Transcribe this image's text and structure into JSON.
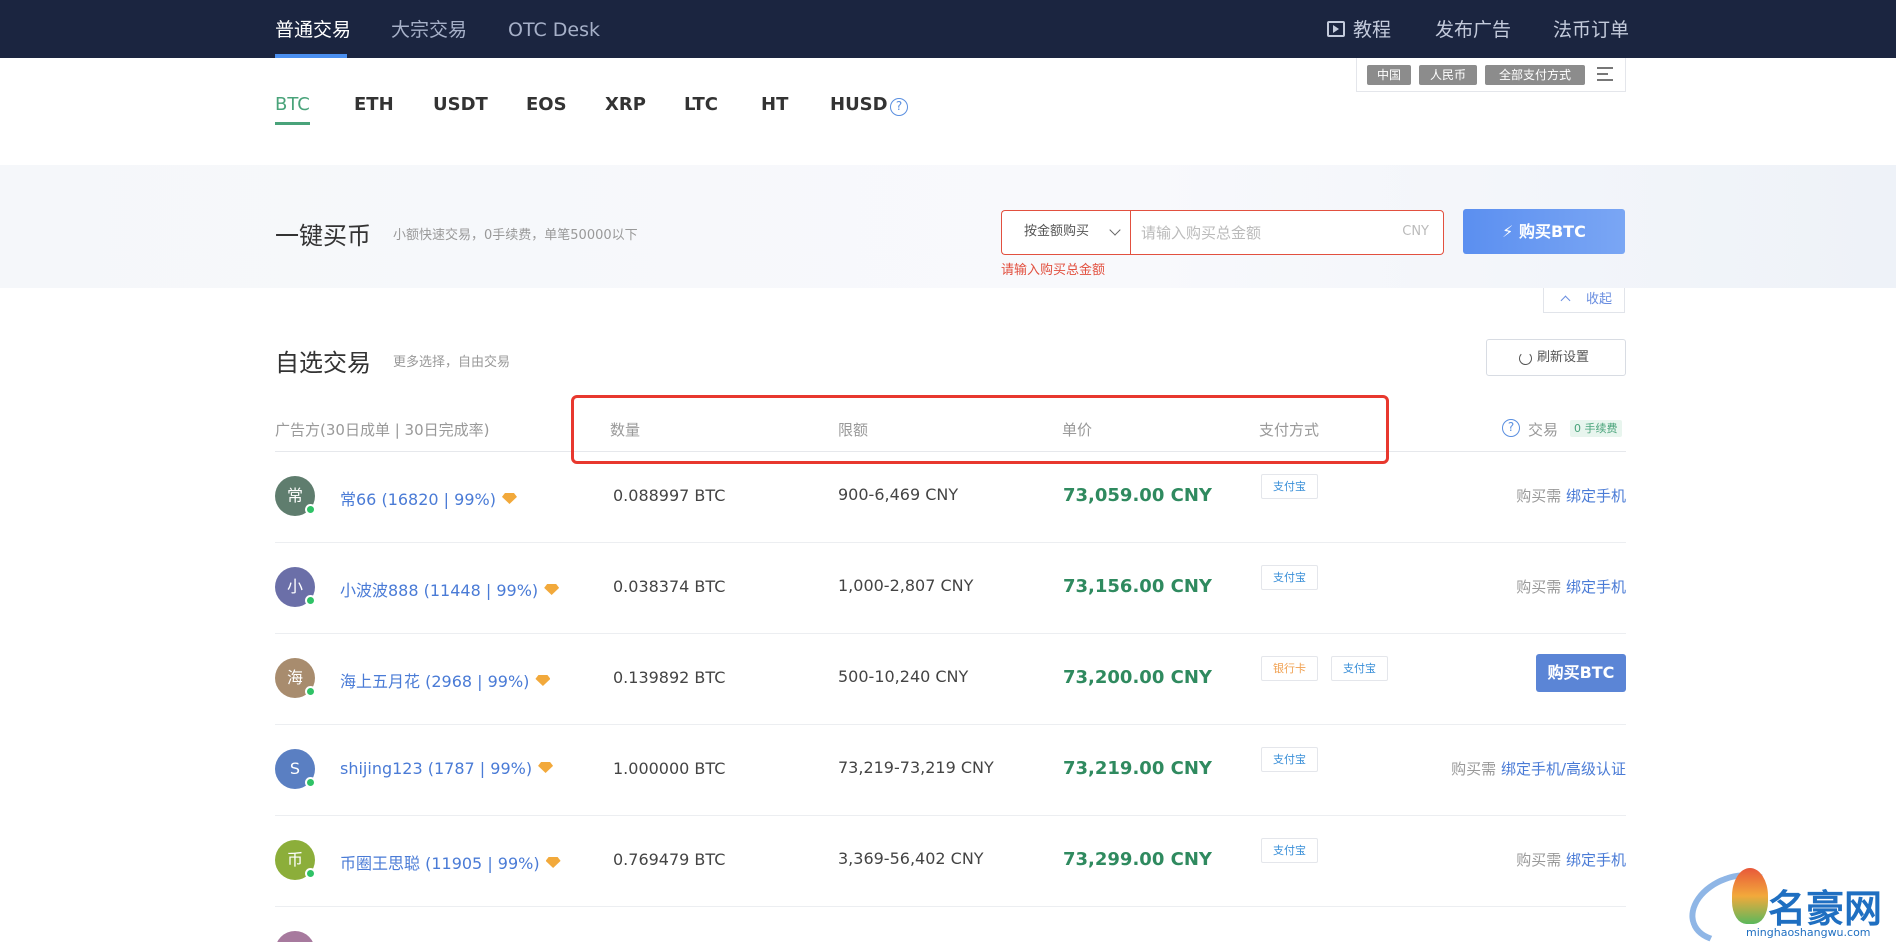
{
  "topnav": {
    "tabs": [
      {
        "label": "普通交易",
        "active": true
      },
      {
        "label": "大宗交易",
        "active": false
      },
      {
        "label": "OTC Desk",
        "active": false
      }
    ],
    "right": {
      "tutorial": "教程",
      "post_ad": "发布广告",
      "orders": "法币订单"
    }
  },
  "coins": [
    "BTC",
    "ETH",
    "USDT",
    "EOS",
    "XRP",
    "LTC",
    "HT",
    "HUSD"
  ],
  "coin_help": "?",
  "filters": {
    "region": "中国",
    "currency": "人民币",
    "payment": "全部支付方式"
  },
  "quick_buy": {
    "title": "一键买币",
    "subtitle": "小额快速交易，0手续费，单笔50000以下",
    "mode": "按金额购买",
    "placeholder": "请输入购买总金额",
    "unit": "CNY",
    "error": "请输入购买总金额",
    "button": "⚡ 购买BTC",
    "collapse": "收起"
  },
  "custom": {
    "title": "自选交易",
    "subtitle": "更多选择，自由交易",
    "refresh": "刷新设置"
  },
  "table": {
    "headers": {
      "advertiser": "广告方(30日成单 | 30日完成率)",
      "qty": "数量",
      "limit": "限额",
      "price": "单价",
      "payment": "支付方式",
      "help": "?",
      "trade": "交易",
      "fee": "0 手续费"
    },
    "rows": [
      {
        "avatar": "常",
        "avatar_color": "#5f7d6e",
        "name": "常66 (16820 | 99%)",
        "qty": "0.088997 BTC",
        "limit": "900-6,469 CNY",
        "price": "73,059.00 CNY",
        "payments": [
          "支付宝"
        ],
        "action_prefix": "购买需",
        "action_link": "绑定手机"
      },
      {
        "avatar": "小",
        "avatar_color": "#6b6fa8",
        "name": "小波波888 (11448 | 99%)",
        "qty": "0.038374 BTC",
        "limit": "1,000-2,807 CNY",
        "price": "73,156.00 CNY",
        "payments": [
          "支付宝"
        ],
        "action_prefix": "购买需",
        "action_link": "绑定手机"
      },
      {
        "avatar": "海",
        "avatar_color": "#a88c6e",
        "name": "海上五月花 (2968 | 99%)",
        "qty": "0.139892 BTC",
        "limit": "500-10,240 CNY",
        "price": "73,200.00 CNY",
        "payments": [
          "银行卡",
          "支付宝"
        ],
        "action_button": "购买BTC"
      },
      {
        "avatar": "S",
        "avatar_color": "#5a7fc2",
        "name": "shijing123 (1787 | 99%)",
        "qty": "1.000000 BTC",
        "limit": "73,219-73,219 CNY",
        "price": "73,219.00 CNY",
        "payments": [
          "支付宝"
        ],
        "action_prefix": "购买需",
        "action_link": "绑定手机/高级认证"
      },
      {
        "avatar": "币",
        "avatar_color": "#8cae3a",
        "name": "币圈王思聪 (11905 | 99%)",
        "qty": "0.769479 BTC",
        "limit": "3,369-56,402 CNY",
        "price": "73,299.00 CNY",
        "payments": [
          "支付宝"
        ],
        "action_prefix": "购买需",
        "action_link": "绑定手机"
      }
    ]
  },
  "watermark": {
    "title": "名豪网",
    "sub": "minghaoshangwu.com"
  }
}
